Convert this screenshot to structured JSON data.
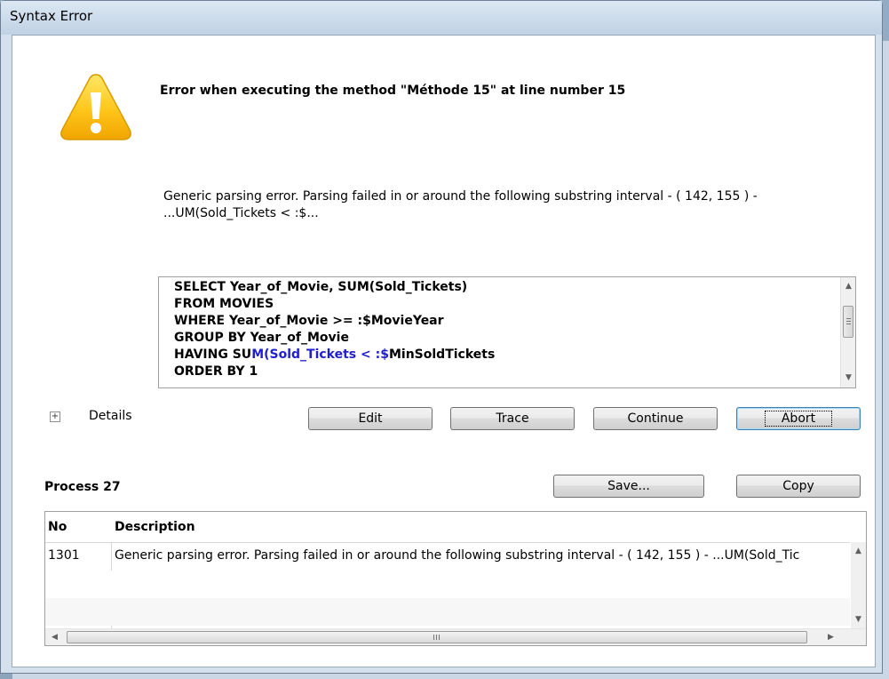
{
  "window": {
    "title": "Syntax Error"
  },
  "dialog": {
    "message": "Error when executing the method \"Méthode 15\" at line number 15",
    "detail_line1": "Generic parsing error. Parsing failed in or around the following substring interval - ( 142, 155 ) -",
    "detail_line2": "...UM(Sold_Tickets < :$...",
    "icon": "warning-icon",
    "code": {
      "line1": "SELECT Year_of_Movie, SUM(Sold_Tickets)",
      "line2": "FROM MOVIES",
      "line3": "WHERE Year_of_Movie >= :$MovieYear",
      "line4": "GROUP BY Year_of_Movie",
      "line5_pre": "HAVING SU",
      "line5_hl": "M(Sold_Tickets < :$",
      "line5_post": "MinSoldTickets",
      "line6": "ORDER BY 1"
    }
  },
  "details": {
    "expander": "+",
    "label": "Details"
  },
  "buttons": {
    "edit": "Edit",
    "trace": "Trace",
    "continue": "Continue",
    "abort": "Abort",
    "save": "Save...",
    "copy": "Copy"
  },
  "process": {
    "label": "Process 27",
    "columns": {
      "no": "No",
      "description": "Description"
    },
    "rows": [
      {
        "no": "1301",
        "description": "Generic parsing error. Parsing failed in or around the following substring interval - ( 142, 155 ) - ...UM(Sold_Tic"
      }
    ]
  },
  "colors": {
    "highlight": "#1f1fd0",
    "default_button_border": "#3c7fb1"
  }
}
